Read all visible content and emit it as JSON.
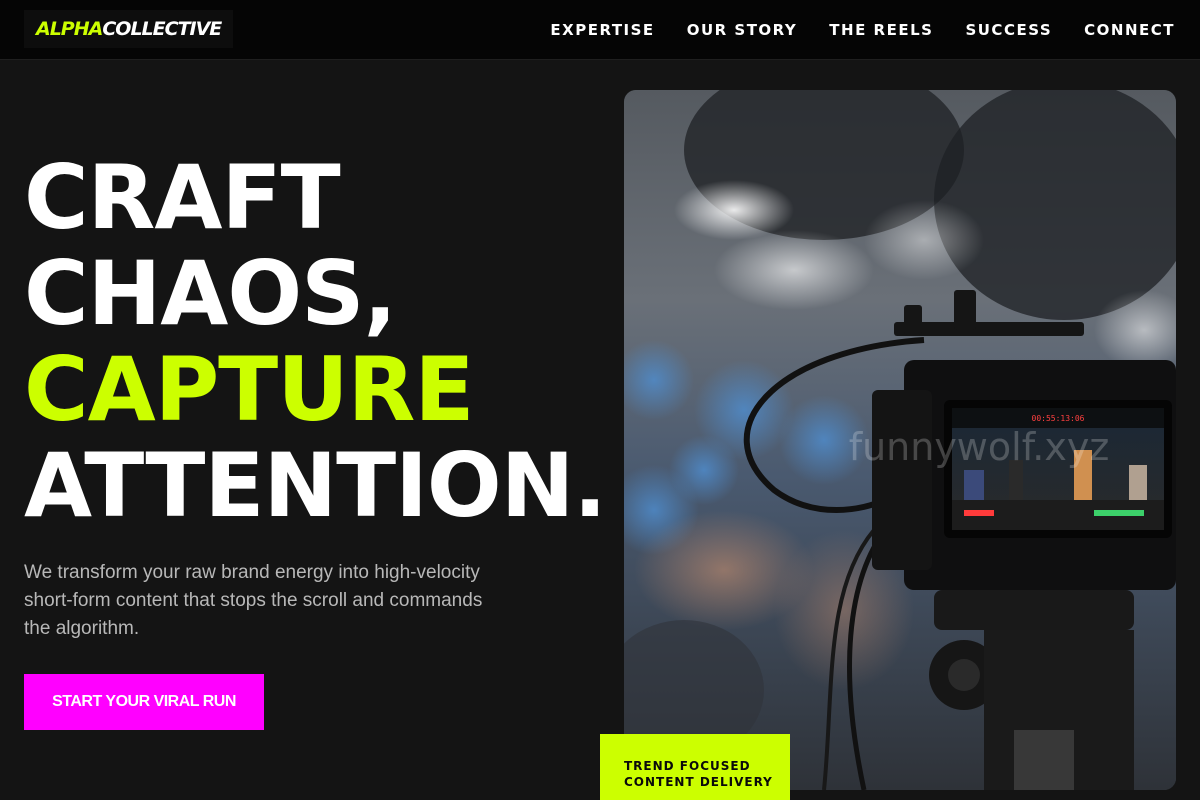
{
  "brand": {
    "logo_part1": "ALPHA",
    "logo_part2": "COLLECTIVE",
    "accent": "#ccff00",
    "cta_color": "#ff00ff"
  },
  "nav": {
    "items": [
      {
        "label": "EXPERTISE"
      },
      {
        "label": "OUR STORY"
      },
      {
        "label": "THE REELS"
      },
      {
        "label": "SUCCESS"
      },
      {
        "label": "CONNECT"
      }
    ]
  },
  "hero": {
    "line1": "CRAFT",
    "line2": "CHAOS,",
    "line3": "CAPTURE",
    "line4": "ATTENTION.",
    "subtext": "We transform your raw brand energy into high-velocity short-form content that stops the scroll and commands the algorithm.",
    "cta_label": "START YOUR VIRAL RUN",
    "image_alt": "video-camera-photo",
    "camera_timecode": "00:55:13:06",
    "watermark": "funnywolf.xyz"
  },
  "badge": {
    "line1": "TREND FOCUSED",
    "line2": "CONTENT DELIVERY"
  }
}
